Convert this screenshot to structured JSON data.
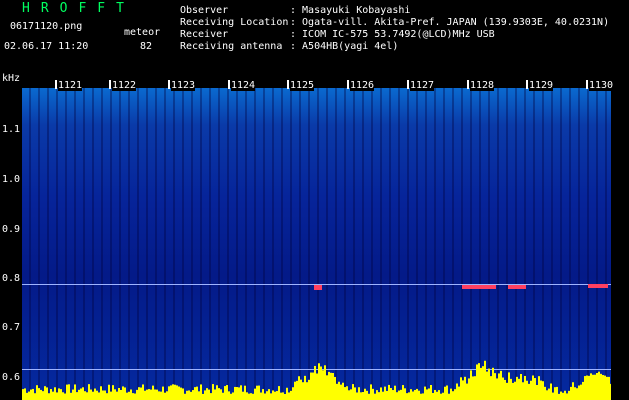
{
  "logo": "HROFFT",
  "file_name": "06171120.png",
  "datetime": "02.06.17 11:20",
  "mode_label": "meteor",
  "count": "82",
  "info": {
    "observer_label": "Observer",
    "observer_value": ": Masayuki Kobayashi",
    "location_label": "Receiving Location",
    "location_value": ": Ogata-vill. Akita-Pref. JAPAN (139.9303E, 40.0231N)",
    "receiver_label": "Receiver",
    "receiver_value": ": ICOM IC-575 53.7492(@LCD)MHz USB",
    "antenna_label": "Receiving antenna",
    "antenna_value": ": A504HB(yagi 4el)"
  },
  "y_axis": {
    "unit": "kHz",
    "ticks": [
      "1.1",
      "1.0",
      "0.9",
      "0.8",
      "0.7",
      "0.6"
    ]
  },
  "time_ticks": [
    "1121",
    "1122",
    "1123",
    "1124",
    "1125",
    "1126",
    "1127",
    "1128",
    "1129",
    "1130"
  ],
  "colors": {
    "background": "#000000",
    "logo": "#00ff60",
    "text": "#ffffff",
    "echo": "#ff4060",
    "signal": "#ffff00"
  }
}
